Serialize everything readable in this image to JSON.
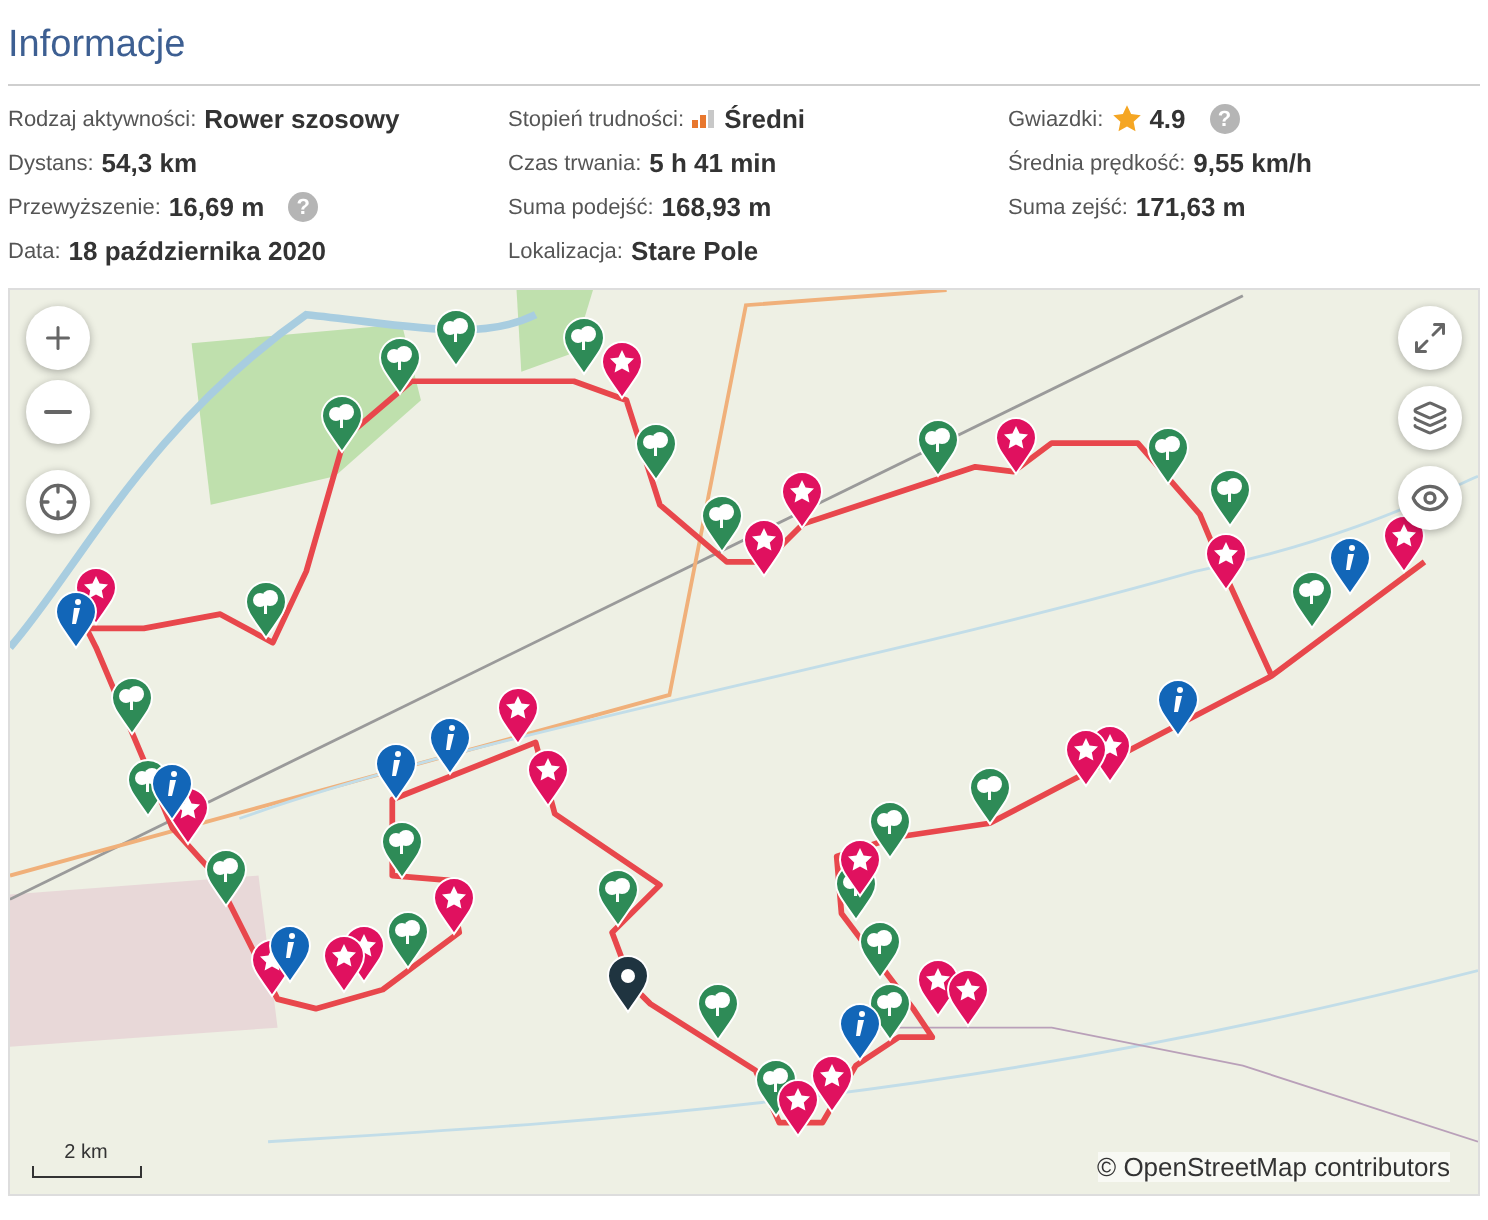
{
  "header": {
    "title": "Informacje"
  },
  "details": [
    {
      "label": "Rodzaj aktywności:",
      "value": "Rower szosowy"
    },
    {
      "label": "Stopień trudności:",
      "value": "Średni",
      "kind": "difficulty",
      "level": 0.67
    },
    {
      "label": "Gwiazdki:",
      "value": "4.9",
      "kind": "rating",
      "help": "?"
    },
    {
      "label": "Dystans:",
      "value": "54,3 km"
    },
    {
      "label": "Czas trwania:",
      "value": "5 h 41 min"
    },
    {
      "label": "Średnia prędkość:",
      "value": "9,55 km/h"
    },
    {
      "label": "Przewyższenie:",
      "value": "16,69 m",
      "help": "?"
    },
    {
      "label": "Suma podejść:",
      "value": "168,93 m"
    },
    {
      "label": "Suma zejść:",
      "value": "171,63 m"
    },
    {
      "label": "Data:",
      "value": "18 października 2020"
    },
    {
      "label": "Lokalizacja:",
      "value": "Stare Pole"
    }
  ],
  "map": {
    "scale": "2 km",
    "attribution": "© OpenStreetMap contributors"
  }
}
